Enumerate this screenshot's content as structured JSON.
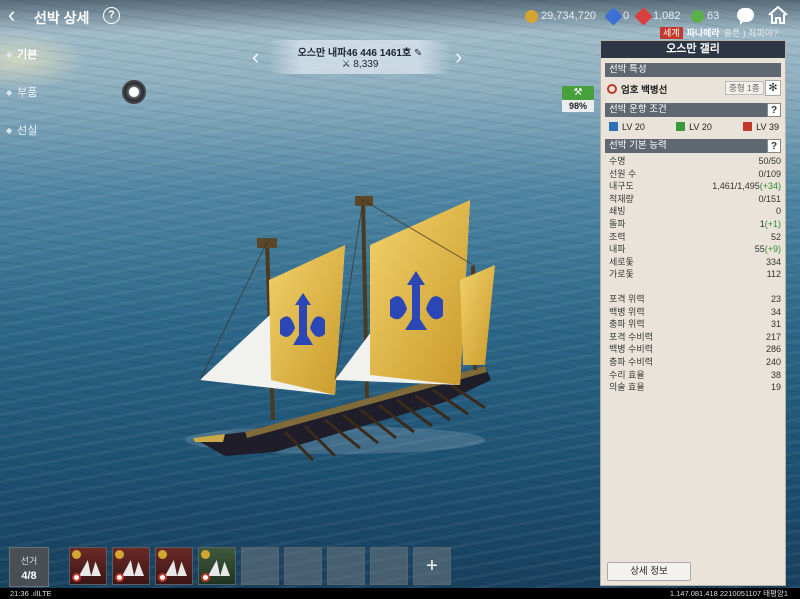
{
  "header": {
    "title": "선박 상세",
    "help": "?"
  },
  "currencies": [
    {
      "name": "gold-coin-icon",
      "value": "29,734,720",
      "color": "#d4a531"
    },
    {
      "name": "blue-gem-icon",
      "value": "0",
      "color": "#3d6fd6"
    },
    {
      "name": "red-gem-icon",
      "value": "1,082",
      "color": "#d6403d"
    },
    {
      "name": "green-gear-icon",
      "value": "63",
      "color": "#5bb04a"
    }
  ],
  "chat": {
    "channel": "세계",
    "name": "파나메라",
    "message": "슬픈 ) 좌파야?"
  },
  "sidebar": {
    "items": [
      {
        "label": "기본"
      },
      {
        "label": "부품"
      },
      {
        "label": "선실"
      }
    ]
  },
  "ship": {
    "name": "오스만 내파46 446 1461호",
    "combat_power": "8,339",
    "durability_pct": "98%"
  },
  "panel": {
    "title": "오스만 갤리",
    "trait_header": "선박 특성",
    "trait_name": "엄호 백병선",
    "trait_level": "중형 1종",
    "req_header": "선박 운항 조건",
    "req": [
      {
        "label": "LV 20",
        "color": "#2f6fb5"
      },
      {
        "label": "LV 20",
        "color": "#3a9a3a"
      },
      {
        "label": "LV 39",
        "color": "#c0392b"
      }
    ],
    "ability_header": "선박 기본 능력",
    "stats_a": [
      {
        "label": "수명",
        "value": "50/50",
        "bonus": ""
      },
      {
        "label": "선원 수",
        "value": "0/109",
        "bonus": ""
      },
      {
        "label": "내구도",
        "value": "1,461/1,495",
        "bonus": "(+34)"
      },
      {
        "label": "적재량",
        "value": "0/151",
        "bonus": ""
      },
      {
        "label": "쇄빙",
        "value": "0",
        "bonus": ""
      },
      {
        "label": "돌파",
        "value": "1",
        "bonus": "(+1)"
      },
      {
        "label": "조력",
        "value": "52",
        "bonus": ""
      },
      {
        "label": "내파",
        "value": "55",
        "bonus": "(+9)"
      },
      {
        "label": "세로돛",
        "value": "334",
        "bonus": ""
      },
      {
        "label": "가로돛",
        "value": "112",
        "bonus": ""
      }
    ],
    "stats_b": [
      {
        "label": "포격 위력",
        "value": "23"
      },
      {
        "label": "백병 위력",
        "value": "34"
      },
      {
        "label": "충파 위력",
        "value": "31"
      },
      {
        "label": "포격 수비력",
        "value": "217"
      },
      {
        "label": "백병 수비력",
        "value": "286"
      },
      {
        "label": "충파 수비력",
        "value": "240"
      },
      {
        "label": "수리 효율",
        "value": "38"
      },
      {
        "label": "의술 효율",
        "value": "19"
      }
    ],
    "detail_button": "상세 정보"
  },
  "fleet": {
    "label": "선거",
    "count": "4/8",
    "add": "+"
  },
  "status": {
    "left": "21:36 .ıllLTE",
    "right": "1.147.081.418 2210051107 태평양1"
  }
}
